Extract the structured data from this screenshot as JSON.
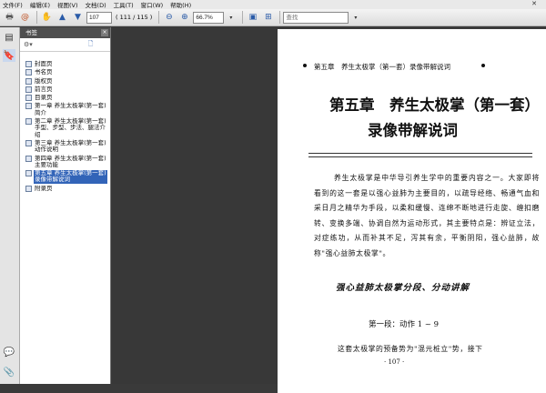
{
  "menu": [
    "文件(F)",
    "编辑(E)",
    "视图(V)",
    "文档(D)",
    "工具(T)",
    "窗口(W)",
    "帮助(H)"
  ],
  "toolbar": {
    "page_current": "107",
    "page_count": "( 111 / 115 )",
    "zoom": "66.7%",
    "search_placeholder": "查找"
  },
  "sidebar": {
    "title": "书签",
    "items": [
      {
        "label": "封面页"
      },
      {
        "label": "书名页"
      },
      {
        "label": "版权页"
      },
      {
        "label": "前言页"
      },
      {
        "label": "目录页"
      },
      {
        "label": "第一章 养生太极掌(第一套)简介"
      },
      {
        "label": "第二章 养生太极掌(第一套)手型、步型、步法、腿法介绍"
      },
      {
        "label": "第三章 养生太极掌(第一套)动作说明"
      },
      {
        "label": "第四章 养生太极掌(第一套)主要功能"
      },
      {
        "label": "第五章 养生太极掌(第一套)录像带解说词"
      },
      {
        "label": "附录页"
      }
    ],
    "selected_index": 9
  },
  "page": {
    "running_head": "第五章　养生太极掌（第一套）录像带解说词",
    "title_line1": "第五章　养生太极掌（第一套）",
    "title_line2": "录像带解说词",
    "paragraph": "养生太极掌是中华导引养生学中的重要内容之一。大家即将看到的这一套是以强心益肺为主要目的，以疏导经络、畅通气血和采日月之精华为手段，以柔和缓慢、连绵不断地进行走旋、缠扣磨转、变换多端、协调自然为运动形式，其主要特点是：辨证立法，对症练功，从而补其不足，泻其有余，平衡阴阳，强心益肺，故称\"强心益肺太极掌\"。",
    "section_heading": "强心益肺太极掌分段、分动讲解",
    "subsection": "第一段：动作 1 ~ 9",
    "paragraph2": "这套太极掌的预备势为\"混元桩立\"势，接下",
    "page_number": "· 107 ·"
  }
}
